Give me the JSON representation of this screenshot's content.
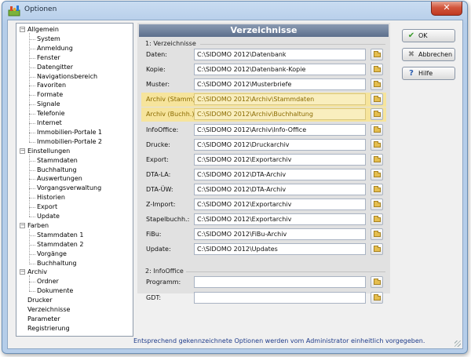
{
  "window": {
    "title": "Optionen",
    "close_symbol": "✕"
  },
  "tree": {
    "items": [
      {
        "label": "Allgemein",
        "level": 0,
        "expandable": true
      },
      {
        "label": "System",
        "level": 1
      },
      {
        "label": "Anmeldung",
        "level": 1
      },
      {
        "label": "Fenster",
        "level": 1
      },
      {
        "label": "Datengitter",
        "level": 1
      },
      {
        "label": "Navigationsbereich",
        "level": 1
      },
      {
        "label": "Favoriten",
        "level": 1
      },
      {
        "label": "Formate",
        "level": 1
      },
      {
        "label": "Signale",
        "level": 1
      },
      {
        "label": "Telefonie",
        "level": 1
      },
      {
        "label": "Internet",
        "level": 1
      },
      {
        "label": "Immobilien-Portale 1",
        "level": 1
      },
      {
        "label": "Immobilien-Portale 2",
        "level": 1
      },
      {
        "label": "Einstellungen",
        "level": 0,
        "expandable": true
      },
      {
        "label": "Stammdaten",
        "level": 1
      },
      {
        "label": "Buchhaltung",
        "level": 1
      },
      {
        "label": "Auswertungen",
        "level": 1
      },
      {
        "label": "Vorgangsverwaltung",
        "level": 1
      },
      {
        "label": "Historien",
        "level": 1
      },
      {
        "label": "Export",
        "level": 1
      },
      {
        "label": "Update",
        "level": 1
      },
      {
        "label": "Farben",
        "level": 0,
        "expandable": true
      },
      {
        "label": "Stammdaten 1",
        "level": 1
      },
      {
        "label": "Stammdaten 2",
        "level": 1
      },
      {
        "label": "Vorgänge",
        "level": 1
      },
      {
        "label": "Buchhaltung",
        "level": 1
      },
      {
        "label": "Archiv",
        "level": 0,
        "expandable": true
      },
      {
        "label": "Ordner",
        "level": 1
      },
      {
        "label": "Dokumente",
        "level": 1
      },
      {
        "label": "Drucker",
        "level": 0
      },
      {
        "label": "Verzeichnisse",
        "level": 0
      },
      {
        "label": "Parameter",
        "level": 0
      },
      {
        "label": "Registrierung",
        "level": 0
      }
    ]
  },
  "panel": {
    "title": "Verzeichnisse",
    "group1_title": "1: Verzeichnisse",
    "group2_title": "2: InfoOffice",
    "rows": [
      {
        "label": "Daten:",
        "value": "C:\\SIDOMO 2012\\Datenbank",
        "highlight": false
      },
      {
        "label": "Kopie:",
        "value": "C:\\SIDOMO 2012\\Datenbank-Kopie",
        "highlight": false
      },
      {
        "label": "Muster:",
        "value": "C:\\SIDOMO 2012\\Musterbriefe",
        "highlight": false
      },
      {
        "label": "Archiv (Stamm):",
        "value": "C:\\SIDOMO 2012\\Archiv\\Stammdaten",
        "highlight": true
      },
      {
        "label": "Archiv (Buchh.):",
        "value": "C:\\SIDOMO 2012\\Archiv\\Buchhaltung",
        "highlight": true
      },
      {
        "label": "InfoOffice:",
        "value": "C:\\SIDOMO 2012\\Archiv\\Info-Office",
        "highlight": false
      },
      {
        "label": "Drucke:",
        "value": "C:\\SIDOMO 2012\\Druckarchiv",
        "highlight": false
      },
      {
        "label": "Export:",
        "value": "C:\\SIDOMO 2012\\Exportarchiv",
        "highlight": false
      },
      {
        "label": "DTA-LA:",
        "value": "C:\\SIDOMO 2012\\DTA-Archiv",
        "highlight": false
      },
      {
        "label": "DTA-ÜW:",
        "value": "C:\\SIDOMO 2012\\DTA-Archiv",
        "highlight": false
      },
      {
        "label": "Z-Import:",
        "value": "C:\\SIDOMO 2012\\Exportarchiv",
        "highlight": false
      },
      {
        "label": "Stapelbuchh.:",
        "value": "C:\\SIDOMO 2012\\Exportarchiv",
        "highlight": false
      },
      {
        "label": "FiBu:",
        "value": "C:\\SIDOMO 2012\\FiBu-Archiv",
        "highlight": false
      },
      {
        "label": "Update:",
        "value": "C:\\SIDOMO 2012\\Updates",
        "highlight": false
      }
    ],
    "info_rows": [
      {
        "label": "Programm:",
        "value": ""
      },
      {
        "label": "GDT:",
        "value": ""
      }
    ]
  },
  "buttons": {
    "ok": {
      "label": "OK",
      "icon": "✔",
      "color": "#3a9a2a"
    },
    "cancel": {
      "label": "Abbrechen",
      "icon": "✖",
      "color": "#8a8a8a"
    },
    "help": {
      "label": "Hilfe",
      "icon": "?",
      "color": "#2a5db0"
    }
  },
  "footer": {
    "text": "Entsprechend gekennzeichnete Optionen werden vom Administrator einheitlich vorgegeben."
  },
  "colors": {
    "highlight": "#f6e49c",
    "header": "#6f819c",
    "footer_text": "#1f3c8a"
  }
}
